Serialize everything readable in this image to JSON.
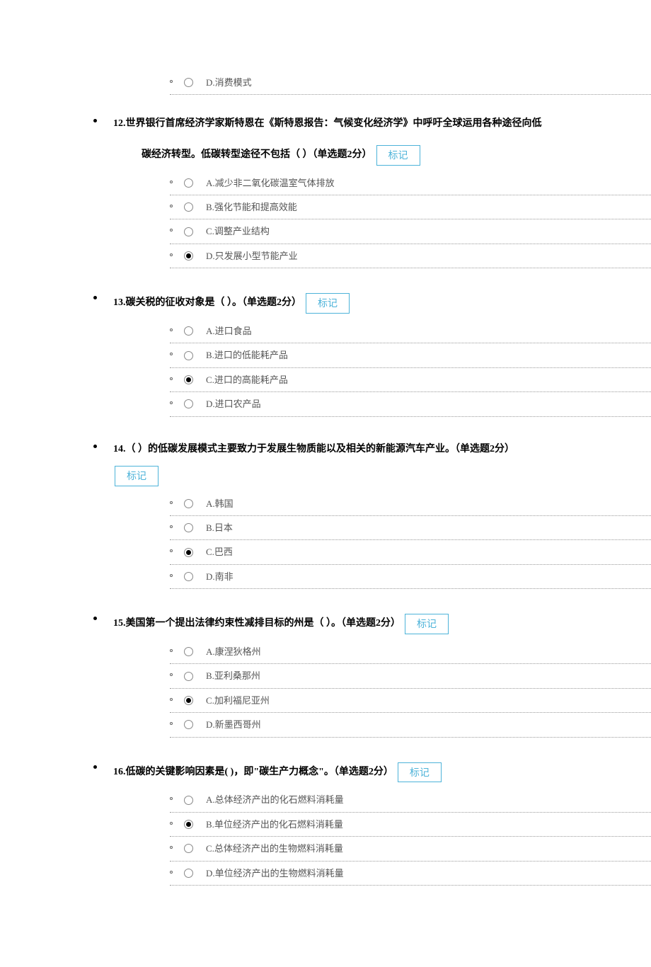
{
  "orphan": {
    "option_d": "D.消费模式"
  },
  "badge_label": "标记",
  "questions": [
    {
      "number_text_line1": "12.世界银行首席经济学家斯特恩在《斯特恩报告：气候变化经济学》中呼吁全球运用各种途径向低",
      "number_text_line2": "碳经济转型。低碳转型途径不包括（ ）（单选题2分）",
      "badge_inline": true,
      "selected": 3,
      "options": [
        "A.减少非二氧化碳温室气体排放",
        "B.强化节能和提高效能",
        "C.调整产业结构",
        "D.只发展小型节能产业"
      ]
    },
    {
      "number_text_line1": "13.碳关税的征收对象是（ ）。（单选题2分）",
      "badge_inline": true,
      "selected": 2,
      "options": [
        "A.进口食品",
        "B.进口的低能耗产品",
        "C.进口的高能耗产品",
        "D.进口农产品"
      ]
    },
    {
      "number_text_line1": "14.（ ）的低碳发展模式主要致力于发展生物质能以及相关的新能源汽车产业。（单选题2分）",
      "badge_inline": false,
      "selected": 2,
      "options": [
        "A.韩国",
        "B.日本",
        "C.巴西",
        "D.南非"
      ]
    },
    {
      "number_text_line1": "15.美国第一个提出法律约束性减排目标的州是（ ）。（单选题2分）",
      "badge_inline": true,
      "selected": 2,
      "options": [
        "A.康涅狄格州",
        "B.亚利桑那州",
        "C.加利福尼亚州",
        "D.新墨西哥州"
      ]
    },
    {
      "number_text_line1": "16.低碳的关键影响因素是( )，即\"碳生产力概念\"。（单选题2分）",
      "badge_inline": true,
      "selected": 1,
      "options": [
        "A.总体经济产出的化石燃料消耗量",
        "B.单位经济产出的化石燃料消耗量",
        "C.总体经济产出的生物燃料消耗量",
        "D.单位经济产出的生物燃料消耗量"
      ]
    }
  ]
}
